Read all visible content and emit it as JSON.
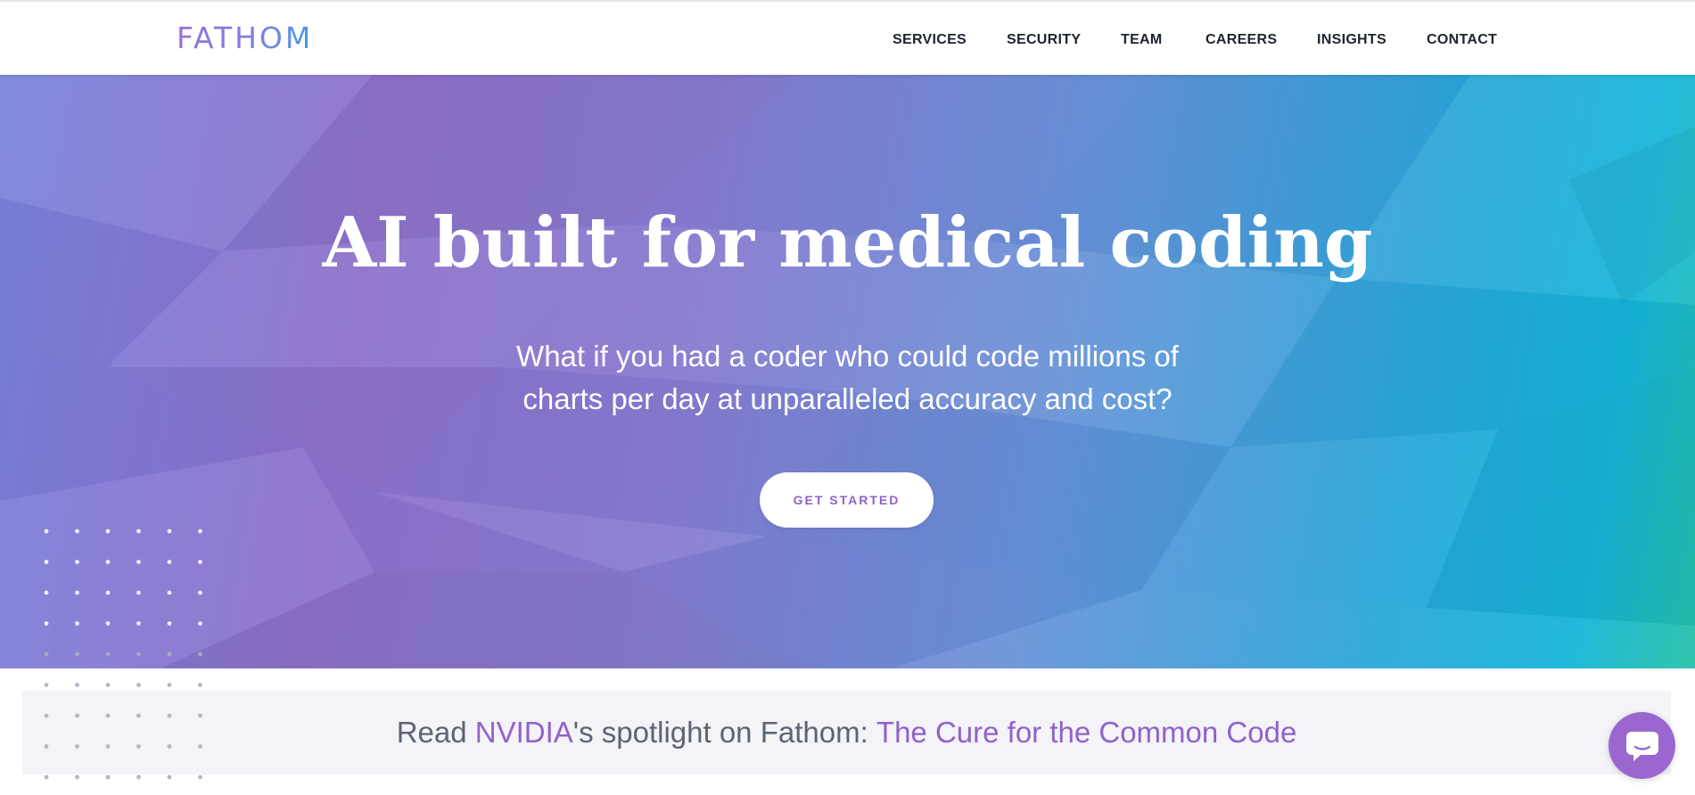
{
  "header": {
    "logo": "FATHOM",
    "nav": [
      "SERVICES",
      "SECURITY",
      "TEAM",
      "CAREERS",
      "INSIGHTS",
      "CONTACT"
    ]
  },
  "hero": {
    "title": "AI built for medical coding",
    "subtitle_lines": [
      "What if you had a coder who could code millions of",
      "charts per day at unparalleled accuracy and cost?"
    ],
    "cta_label": "GET STARTED"
  },
  "spotlight": {
    "prefix": "Read ",
    "brand_link": "NVIDIA",
    "middle": "'s spotlight on Fathom: ",
    "article_link": "The Cure for the Common Code"
  },
  "icons": {
    "chat": "chat-bubble-icon"
  },
  "colors": {
    "accent_purple": "#8f63c8",
    "nav_text": "#1d2330",
    "gradient_left": "#8e72cb",
    "gradient_right": "#16b6d8",
    "gradient_corner": "#26c2a8"
  }
}
